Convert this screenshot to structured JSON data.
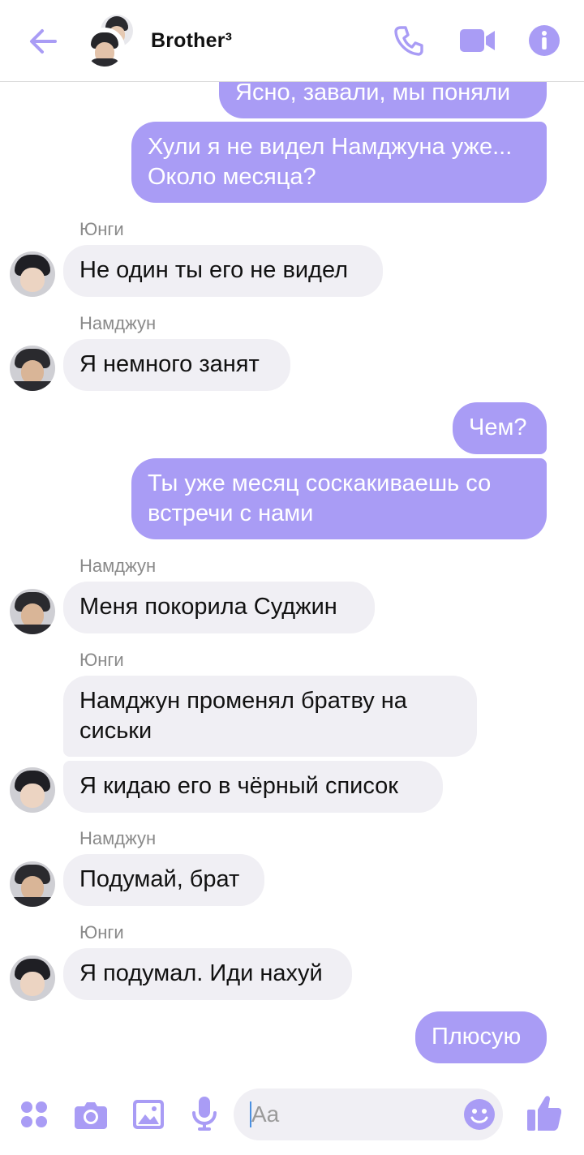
{
  "header": {
    "title": "Brother³",
    "icons": [
      "back-arrow-icon",
      "phone-icon",
      "video-camera-icon",
      "info-icon"
    ],
    "accent": "#a99cf5"
  },
  "messages": [
    {
      "side": "out",
      "text": "Ясно, завали, мы поняли"
    },
    {
      "side": "out",
      "text": "Хули я не видел Намджуна уже... Около месяца?"
    },
    {
      "side": "in",
      "sender": "Юнги",
      "text": "Не один ты его не видел"
    },
    {
      "side": "in",
      "sender": "Намджун",
      "text": "Я немного занят"
    },
    {
      "side": "out",
      "text": "Чем?"
    },
    {
      "side": "out",
      "text": "Ты уже месяц соскакиваешь со встречи с нами"
    },
    {
      "side": "in",
      "sender": "Намджун",
      "text": "Меня покорила Суджин"
    },
    {
      "side": "in",
      "sender": "Юнги",
      "text": "Намджун променял братву на сиськи"
    },
    {
      "side": "in",
      "text": "Я кидаю его в чёрный список"
    },
    {
      "side": "in",
      "sender": "Намджун",
      "text": "Подумай, брат"
    },
    {
      "side": "in",
      "sender": "Юнги",
      "text": "Я подумал. Иди нахуй"
    },
    {
      "side": "out",
      "text": "Плюсую"
    }
  ],
  "composer": {
    "placeholder": "Aa",
    "icons": [
      "apps-icon",
      "camera-icon",
      "gallery-icon",
      "microphone-icon",
      "emoji-icon",
      "thumbs-up-icon"
    ]
  },
  "colors": {
    "outgoing_bubble": "#a99cf5",
    "incoming_bubble": "#f0eff4",
    "sender_name": "#8a8a8a"
  }
}
